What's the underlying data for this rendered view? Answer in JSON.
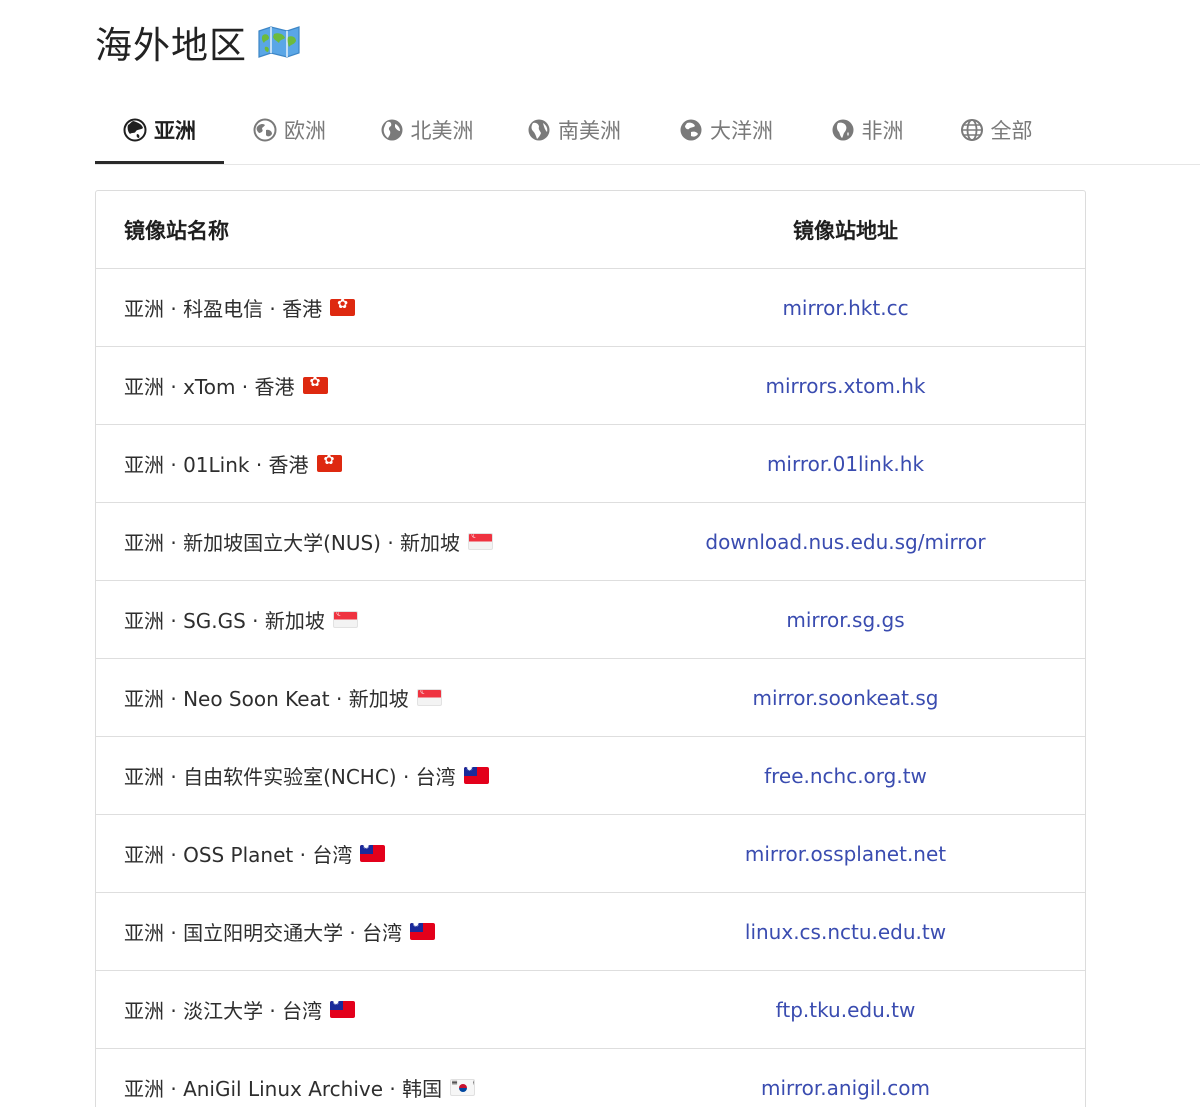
{
  "page": {
    "title": "海外地区"
  },
  "tabs": [
    {
      "label": "亚洲",
      "icon": "globe-asia-icon",
      "active": true
    },
    {
      "label": "欧洲",
      "icon": "globe-europe-icon",
      "active": false
    },
    {
      "label": "北美洲",
      "icon": "globe-americas-icon",
      "active": false
    },
    {
      "label": "南美洲",
      "icon": "globe-americas-icon",
      "active": false
    },
    {
      "label": "大洋洲",
      "icon": "globe-oceania-icon",
      "active": false
    },
    {
      "label": "非洲",
      "icon": "globe-africa-icon",
      "active": false
    },
    {
      "label": "全部",
      "icon": "globe-grid-icon",
      "active": false
    }
  ],
  "table": {
    "headers": {
      "name": "镜像站名称",
      "url": "镜像站地址"
    },
    "rows": [
      {
        "name": "亚洲 · 科盈电信 · 香港",
        "flag": "hk",
        "url": "mirror.hkt.cc"
      },
      {
        "name": "亚洲 · xTom · 香港",
        "flag": "hk",
        "url": "mirrors.xtom.hk"
      },
      {
        "name": "亚洲 · 01Link · 香港",
        "flag": "hk",
        "url": "mirror.01link.hk"
      },
      {
        "name": "亚洲 · 新加坡国立大学(NUS) · 新加坡",
        "flag": "sg",
        "url": "download.nus.edu.sg/mirror"
      },
      {
        "name": "亚洲 · SG.GS · 新加坡",
        "flag": "sg",
        "url": "mirror.sg.gs"
      },
      {
        "name": "亚洲 · Neo Soon Keat · 新加坡",
        "flag": "sg",
        "url": "mirror.soonkeat.sg"
      },
      {
        "name": "亚洲 · 自由软件实验室(NCHC) · 台湾",
        "flag": "tw",
        "url": "free.nchc.org.tw"
      },
      {
        "name": "亚洲 · OSS Planet · 台湾",
        "flag": "tw",
        "url": "mirror.ossplanet.net"
      },
      {
        "name": "亚洲 · 国立阳明交通大学 · 台湾",
        "flag": "tw",
        "url": "linux.cs.nctu.edu.tw"
      },
      {
        "name": "亚洲 · 淡江大学 · 台湾",
        "flag": "tw",
        "url": "ftp.tku.edu.tw"
      },
      {
        "name": "亚洲 · AniGil Linux Archive · 韩国",
        "flag": "kr",
        "url": "mirror.anigil.com"
      }
    ]
  },
  "colors": {
    "link": "#3a4cb0",
    "active_tab": "#1f1f1f",
    "inactive_tab": "#7a7a7a"
  }
}
